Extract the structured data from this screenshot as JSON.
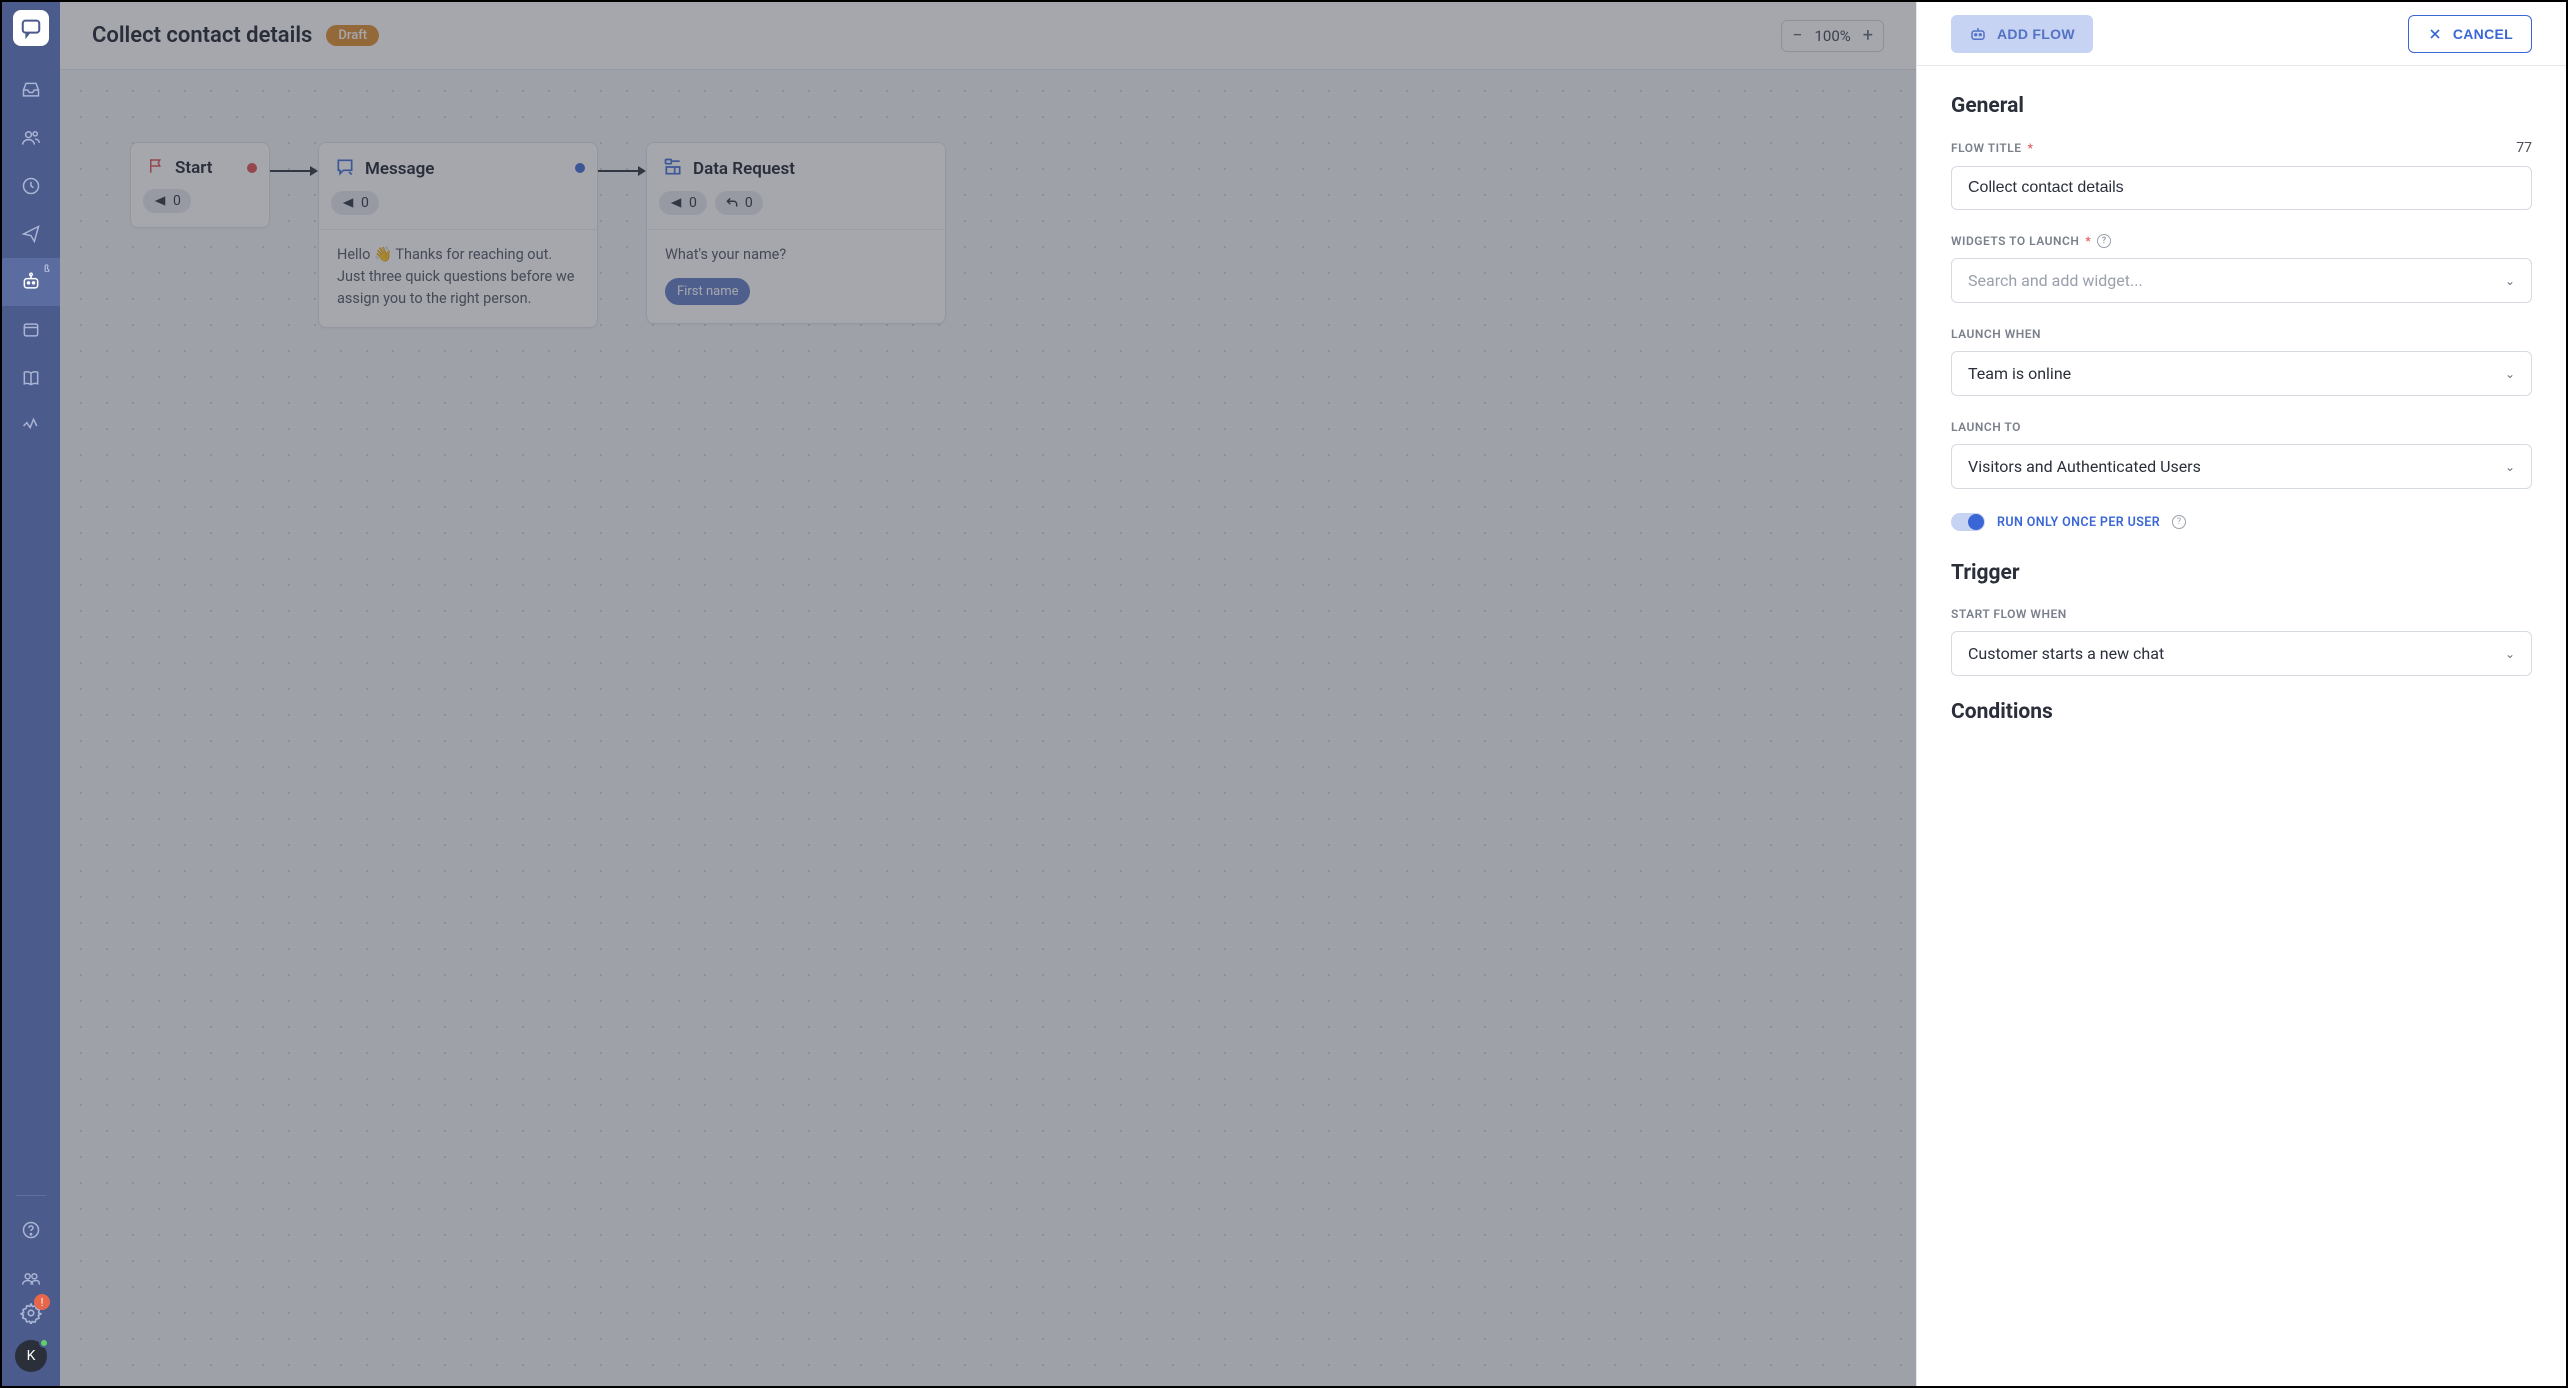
{
  "sidebar": {
    "logo_icon": "chat-bubble",
    "items": [
      {
        "name": "inbox-icon"
      },
      {
        "name": "users-icon"
      },
      {
        "name": "clock-icon"
      },
      {
        "name": "send-icon"
      },
      {
        "name": "bot-icon",
        "badge": "ß",
        "active": true
      },
      {
        "name": "window-icon"
      },
      {
        "name": "book-icon"
      },
      {
        "name": "activity-icon"
      }
    ],
    "help_icon": "help",
    "team_icon": "team",
    "gear_badge": "!",
    "avatar_initial": "K"
  },
  "topbar": {
    "title": "Collect contact details",
    "status": "Draft",
    "zoom": "100%"
  },
  "nodes": {
    "start": {
      "title": "Start",
      "out_count": "0"
    },
    "message": {
      "title": "Message",
      "out_count": "0",
      "body": "Hello 👋 Thanks for reaching out. Just three quick questions before we assign you to the right person."
    },
    "data_request": {
      "title": "Data Request",
      "out_count": "0",
      "in_count": "0",
      "body": "What's your name?",
      "tag": "First name"
    }
  },
  "panel": {
    "add_flow_label": "ADD FLOW",
    "cancel_label": "CANCEL",
    "general": {
      "heading": "General",
      "flow_title_label": "FLOW TITLE",
      "flow_title_value": "Collect contact details",
      "flow_title_count": "77",
      "widgets_label": "WIDGETS TO LAUNCH",
      "widgets_placeholder": "Search and add widget...",
      "launch_when_label": "LAUNCH WHEN",
      "launch_when_value": "Team is online",
      "launch_to_label": "LAUNCH TO",
      "launch_to_value": "Visitors and Authenticated Users",
      "run_once_label": "RUN ONLY ONCE PER USER"
    },
    "trigger": {
      "heading": "Trigger",
      "start_when_label": "START FLOW WHEN",
      "start_when_value": "Customer starts a new chat"
    },
    "conditions": {
      "heading": "Conditions"
    }
  }
}
